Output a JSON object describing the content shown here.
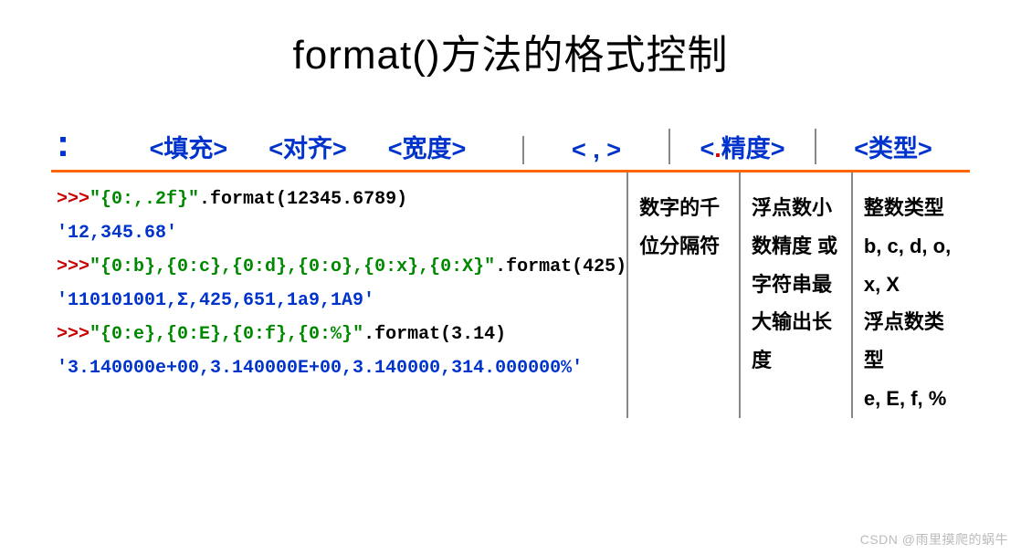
{
  "title": "format()方法的格式控制",
  "headers": {
    "colon": ":",
    "fill": "<填充>",
    "align": "<对齐>",
    "width": "<宽度>",
    "comma": "< , >",
    "precision_prefix": "<",
    "precision_dot": ".",
    "precision_suffix": "精度>",
    "type": "<类型>"
  },
  "code": {
    "p1_prompt": ">>>",
    "p1_str": "\"{0:,.2f}\"",
    "p1_call": ".format(12345.6789)",
    "p1_result": "'12,345.68'",
    "p2_prompt": ">>>",
    "p2_str": "\"{0:b},{0:c},{0:d},{0:o},{0:x},{0:X}\"",
    "p2_call": ".format(425)",
    "p2_result": "'110101001,Σ,425,651,1a9,1A9'",
    "p3_prompt": ">>>",
    "p3_str": "\"{0:e},{0:E},{0:f},{0:%}\"",
    "p3_call": ".format(3.14)",
    "p3_result": "'3.140000e+00,3.140000E+00,3.140000,314.000000%'"
  },
  "desc": {
    "comma": "数字的千位分隔符",
    "precision": "浮点数小数精度 或 字符串最大输出长度",
    "type_l1": "整数类型",
    "type_l2": "b, c, d, o, x, X",
    "type_l3": "浮点数类型",
    "type_l4": "e, E, f, %"
  },
  "watermark": "CSDN @雨里摸爬的蜗牛"
}
